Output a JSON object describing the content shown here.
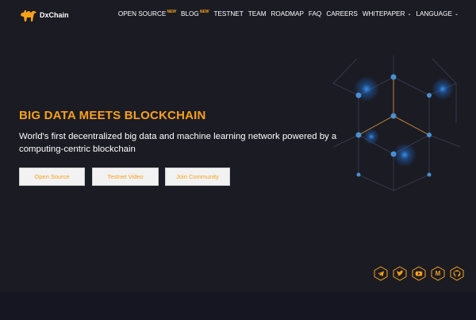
{
  "brand": {
    "name": "DxChain"
  },
  "nav": {
    "items": [
      {
        "label": "OPEN SOURCE",
        "badge": "NEW"
      },
      {
        "label": "BLOG",
        "badge": "NEW"
      },
      {
        "label": "TESTNET"
      },
      {
        "label": "TEAM"
      },
      {
        "label": "ROADMAP"
      },
      {
        "label": "FAQ"
      },
      {
        "label": "CAREERS"
      },
      {
        "label": "WHITEPAPER"
      },
      {
        "label": "LANGUAGE"
      }
    ]
  },
  "hero": {
    "title": "BIG DATA MEETS BLOCKCHAIN",
    "subtitle": "World's first decentralized big data and machine learning network powered by a computing-centric blockchain",
    "buttons": {
      "open_source": "Open Source",
      "testnet_video": "Testnet Video",
      "join_community": "Join Community"
    }
  },
  "social": [
    {
      "icon": "telegram-icon"
    },
    {
      "icon": "twitter-icon"
    },
    {
      "icon": "youtube-icon"
    },
    {
      "icon": "medium-icon",
      "glyph": "M"
    },
    {
      "icon": "github-icon"
    }
  ],
  "colors": {
    "accent": "#f7a11a",
    "background": "#1b1b24",
    "button_bg": "#f2f2f2"
  }
}
